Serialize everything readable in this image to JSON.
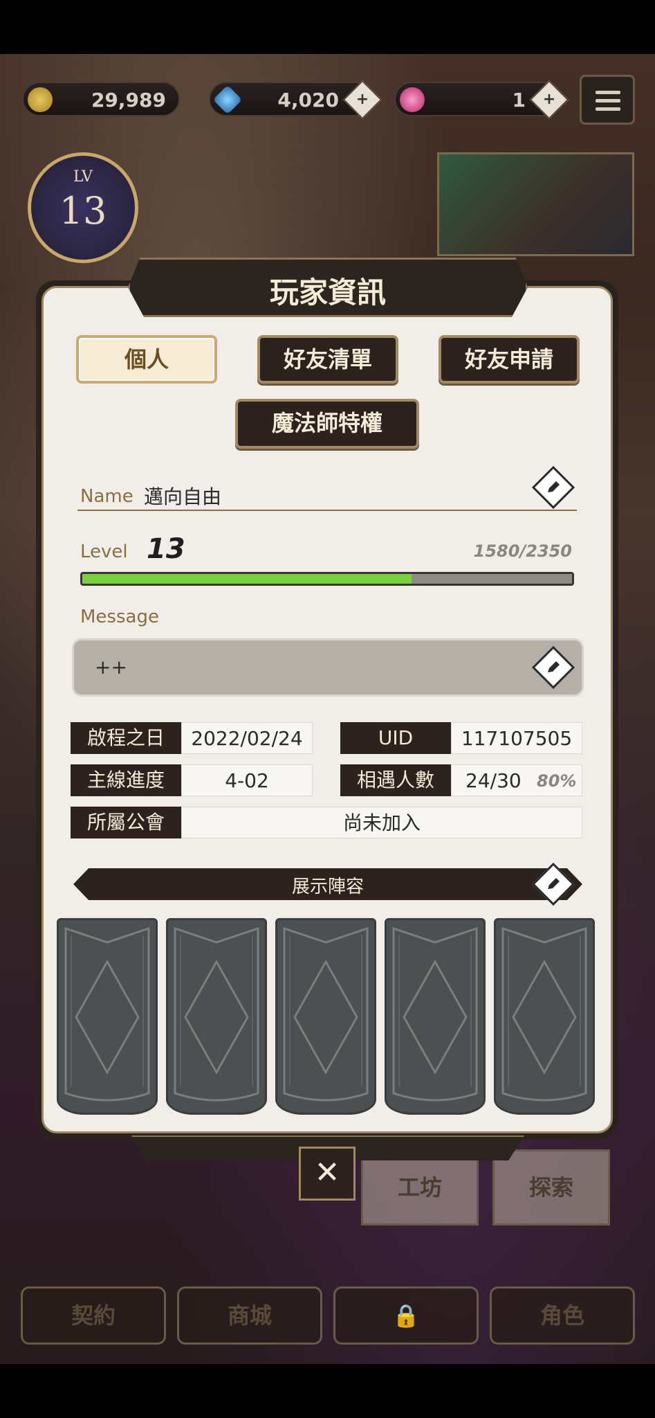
{
  "currencies": [
    {
      "icon": "gold-coin-icon",
      "value": "29,989"
    },
    {
      "icon": "blue-gem-icon",
      "value": "4,020"
    },
    {
      "icon": "pink-gem-icon",
      "value": "1"
    }
  ],
  "plus_glyph": "+",
  "player_level_badge": {
    "lv": "LV",
    "level": "13"
  },
  "dialog": {
    "title": "玩家資訊",
    "tabs": [
      "個人",
      "好友清單",
      "好友申請"
    ],
    "privilege_button": "魔法師特權",
    "name_label": "Name",
    "name_value": "邁向自由",
    "level_label": "Level",
    "level_value": "13",
    "exp_text": "1580/2350",
    "exp_fraction": 0.6723,
    "message_label": "Message",
    "message_value": "++",
    "info": {
      "start_date_label": "啟程之日",
      "start_date_value": "2022/02/24",
      "uid_label": "UID",
      "uid_value": "117107505",
      "progress_label": "主線進度",
      "progress_value": "4-02",
      "encounter_label": "相遇人數",
      "encounter_value": "24/30",
      "encounter_pct": "80%",
      "guild_label": "所屬公會",
      "guild_value": "尚未加入"
    },
    "lineup_label": "展示陣容",
    "close_glyph": "✕"
  },
  "background_buttons": {
    "workshop": "工坊",
    "explore": "探索",
    "contract": "契約",
    "shop": "商城",
    "character": "角色"
  }
}
